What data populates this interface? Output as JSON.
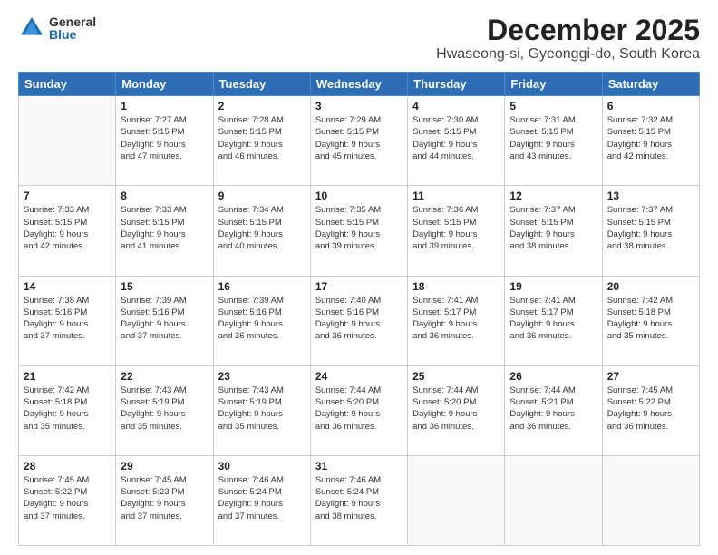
{
  "logo": {
    "general": "General",
    "blue": "Blue"
  },
  "title": "December 2025",
  "subtitle": "Hwaseong-si, Gyeonggi-do, South Korea",
  "days_of_week": [
    "Sunday",
    "Monday",
    "Tuesday",
    "Wednesday",
    "Thursday",
    "Friday",
    "Saturday"
  ],
  "weeks": [
    [
      {
        "day": "",
        "info": ""
      },
      {
        "day": "1",
        "info": "Sunrise: 7:27 AM\nSunset: 5:15 PM\nDaylight: 9 hours\nand 47 minutes."
      },
      {
        "day": "2",
        "info": "Sunrise: 7:28 AM\nSunset: 5:15 PM\nDaylight: 9 hours\nand 46 minutes."
      },
      {
        "day": "3",
        "info": "Sunrise: 7:29 AM\nSunset: 5:15 PM\nDaylight: 9 hours\nand 45 minutes."
      },
      {
        "day": "4",
        "info": "Sunrise: 7:30 AM\nSunset: 5:15 PM\nDaylight: 9 hours\nand 44 minutes."
      },
      {
        "day": "5",
        "info": "Sunrise: 7:31 AM\nSunset: 5:15 PM\nDaylight: 9 hours\nand 43 minutes."
      },
      {
        "day": "6",
        "info": "Sunrise: 7:32 AM\nSunset: 5:15 PM\nDaylight: 9 hours\nand 42 minutes."
      }
    ],
    [
      {
        "day": "7",
        "info": "Sunrise: 7:33 AM\nSunset: 5:15 PM\nDaylight: 9 hours\nand 42 minutes."
      },
      {
        "day": "8",
        "info": "Sunrise: 7:33 AM\nSunset: 5:15 PM\nDaylight: 9 hours\nand 41 minutes."
      },
      {
        "day": "9",
        "info": "Sunrise: 7:34 AM\nSunset: 5:15 PM\nDaylight: 9 hours\nand 40 minutes."
      },
      {
        "day": "10",
        "info": "Sunrise: 7:35 AM\nSunset: 5:15 PM\nDaylight: 9 hours\nand 39 minutes."
      },
      {
        "day": "11",
        "info": "Sunrise: 7:36 AM\nSunset: 5:15 PM\nDaylight: 9 hours\nand 39 minutes."
      },
      {
        "day": "12",
        "info": "Sunrise: 7:37 AM\nSunset: 5:15 PM\nDaylight: 9 hours\nand 38 minutes."
      },
      {
        "day": "13",
        "info": "Sunrise: 7:37 AM\nSunset: 5:15 PM\nDaylight: 9 hours\nand 38 minutes."
      }
    ],
    [
      {
        "day": "14",
        "info": "Sunrise: 7:38 AM\nSunset: 5:16 PM\nDaylight: 9 hours\nand 37 minutes."
      },
      {
        "day": "15",
        "info": "Sunrise: 7:39 AM\nSunset: 5:16 PM\nDaylight: 9 hours\nand 37 minutes."
      },
      {
        "day": "16",
        "info": "Sunrise: 7:39 AM\nSunset: 5:16 PM\nDaylight: 9 hours\nand 36 minutes."
      },
      {
        "day": "17",
        "info": "Sunrise: 7:40 AM\nSunset: 5:16 PM\nDaylight: 9 hours\nand 36 minutes."
      },
      {
        "day": "18",
        "info": "Sunrise: 7:41 AM\nSunset: 5:17 PM\nDaylight: 9 hours\nand 36 minutes."
      },
      {
        "day": "19",
        "info": "Sunrise: 7:41 AM\nSunset: 5:17 PM\nDaylight: 9 hours\nand 36 minutes."
      },
      {
        "day": "20",
        "info": "Sunrise: 7:42 AM\nSunset: 5:18 PM\nDaylight: 9 hours\nand 35 minutes."
      }
    ],
    [
      {
        "day": "21",
        "info": "Sunrise: 7:42 AM\nSunset: 5:18 PM\nDaylight: 9 hours\nand 35 minutes."
      },
      {
        "day": "22",
        "info": "Sunrise: 7:43 AM\nSunset: 5:19 PM\nDaylight: 9 hours\nand 35 minutes."
      },
      {
        "day": "23",
        "info": "Sunrise: 7:43 AM\nSunset: 5:19 PM\nDaylight: 9 hours\nand 35 minutes."
      },
      {
        "day": "24",
        "info": "Sunrise: 7:44 AM\nSunset: 5:20 PM\nDaylight: 9 hours\nand 36 minutes."
      },
      {
        "day": "25",
        "info": "Sunrise: 7:44 AM\nSunset: 5:20 PM\nDaylight: 9 hours\nand 36 minutes."
      },
      {
        "day": "26",
        "info": "Sunrise: 7:44 AM\nSunset: 5:21 PM\nDaylight: 9 hours\nand 36 minutes."
      },
      {
        "day": "27",
        "info": "Sunrise: 7:45 AM\nSunset: 5:22 PM\nDaylight: 9 hours\nand 36 minutes."
      }
    ],
    [
      {
        "day": "28",
        "info": "Sunrise: 7:45 AM\nSunset: 5:22 PM\nDaylight: 9 hours\nand 37 minutes."
      },
      {
        "day": "29",
        "info": "Sunrise: 7:45 AM\nSunset: 5:23 PM\nDaylight: 9 hours\nand 37 minutes."
      },
      {
        "day": "30",
        "info": "Sunrise: 7:46 AM\nSunset: 5:24 PM\nDaylight: 9 hours\nand 37 minutes."
      },
      {
        "day": "31",
        "info": "Sunrise: 7:46 AM\nSunset: 5:24 PM\nDaylight: 9 hours\nand 38 minutes."
      },
      {
        "day": "",
        "info": ""
      },
      {
        "day": "",
        "info": ""
      },
      {
        "day": "",
        "info": ""
      }
    ]
  ]
}
